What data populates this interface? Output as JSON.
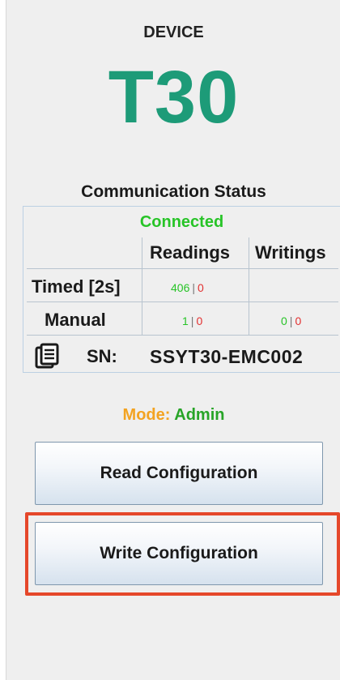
{
  "device": {
    "label": "DEVICE",
    "model": "T30"
  },
  "communication": {
    "title": "Communication Status",
    "state": "Connected",
    "columns": [
      "Readings",
      "Writings"
    ],
    "rows": [
      {
        "label": "Timed [2s]",
        "readings_ok": "406",
        "readings_err": "0",
        "writings_ok": "",
        "writings_err": ""
      },
      {
        "label": "Manual",
        "readings_ok": "1",
        "readings_err": "0",
        "writings_ok": "0",
        "writings_err": "0"
      }
    ],
    "separator": "|",
    "sn_label": "SN:",
    "sn_value": "SSYT30-EMC002",
    "sn_icon": "document-stack-icon"
  },
  "mode": {
    "key": "Mode:",
    "value": "Admin"
  },
  "buttons": {
    "read": "Read Configuration",
    "write": "Write Configuration"
  },
  "colors": {
    "model": "#1d9b78",
    "connected": "#27c427",
    "error": "#e23030",
    "mode_key": "#f3a321",
    "mode_value": "#27a427",
    "highlight": "#e5472a"
  }
}
